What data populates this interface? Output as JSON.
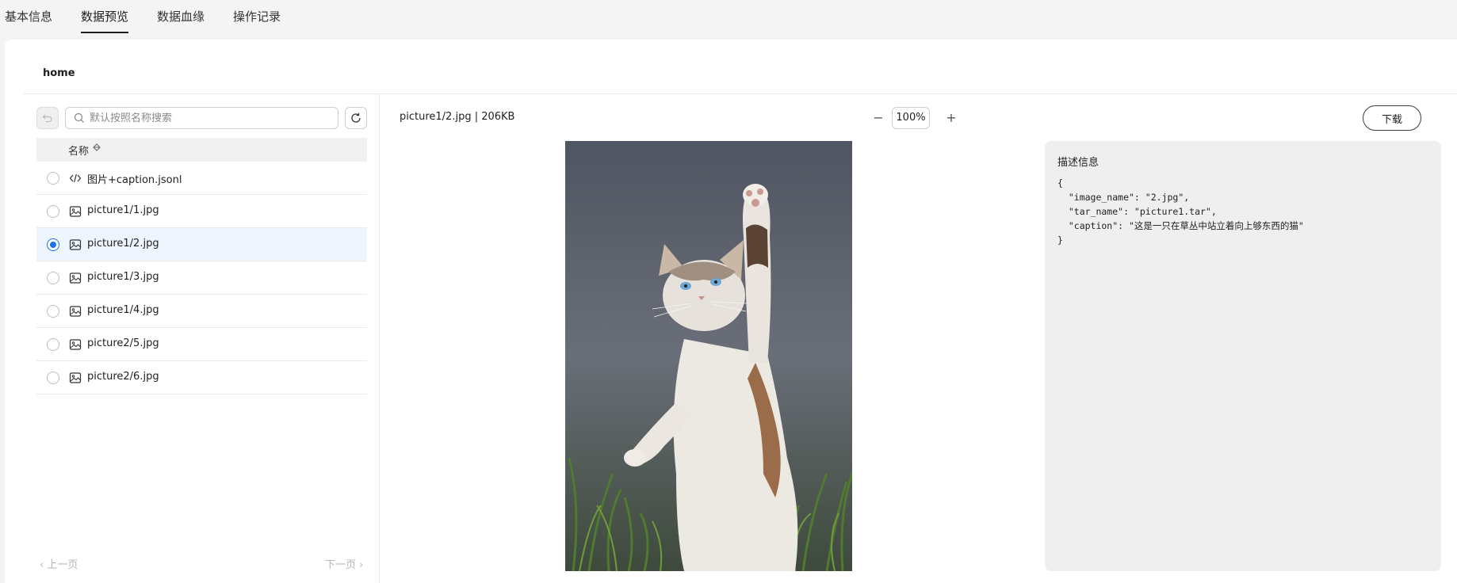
{
  "tabs": [
    {
      "label": "基本信息",
      "active": false
    },
    {
      "label": "数据预览",
      "active": true
    },
    {
      "label": "数据血缘",
      "active": false
    },
    {
      "label": "操作记录",
      "active": false
    }
  ],
  "breadcrumb": "home",
  "search": {
    "placeholder": "默认按照名称搜索",
    "value": ""
  },
  "table": {
    "header_name": "名称"
  },
  "files": [
    {
      "name": "图片+caption.jsonl",
      "icon": "code-icon",
      "selected": false
    },
    {
      "name": "picture1/1.jpg",
      "icon": "image-icon",
      "selected": false
    },
    {
      "name": "picture1/2.jpg",
      "icon": "image-icon",
      "selected": true
    },
    {
      "name": "picture1/3.jpg",
      "icon": "image-icon",
      "selected": false
    },
    {
      "name": "picture1/4.jpg",
      "icon": "image-icon",
      "selected": false
    },
    {
      "name": "picture2/5.jpg",
      "icon": "image-icon",
      "selected": false
    },
    {
      "name": "picture2/6.jpg",
      "icon": "image-icon",
      "selected": false
    }
  ],
  "pager": {
    "prev": "上一页",
    "next": "下一页"
  },
  "preview": {
    "file_info": "picture1/2.jpg | 206KB",
    "zoom": "100%",
    "zoom_out_symbol": "−",
    "zoom_in_symbol": "+",
    "download_label": "下载"
  },
  "description": {
    "title": "描述信息",
    "json_lines": [
      "{",
      "  \"image_name\": \"2.jpg\",",
      "  \"tar_name\": \"picture1.tar\",",
      "  \"caption\": \"这是一只在草丛中站立着向上够东西的猫\"",
      "}"
    ]
  },
  "colors": {
    "accent": "#1a73e8",
    "selected_row": "#eef5fe"
  }
}
